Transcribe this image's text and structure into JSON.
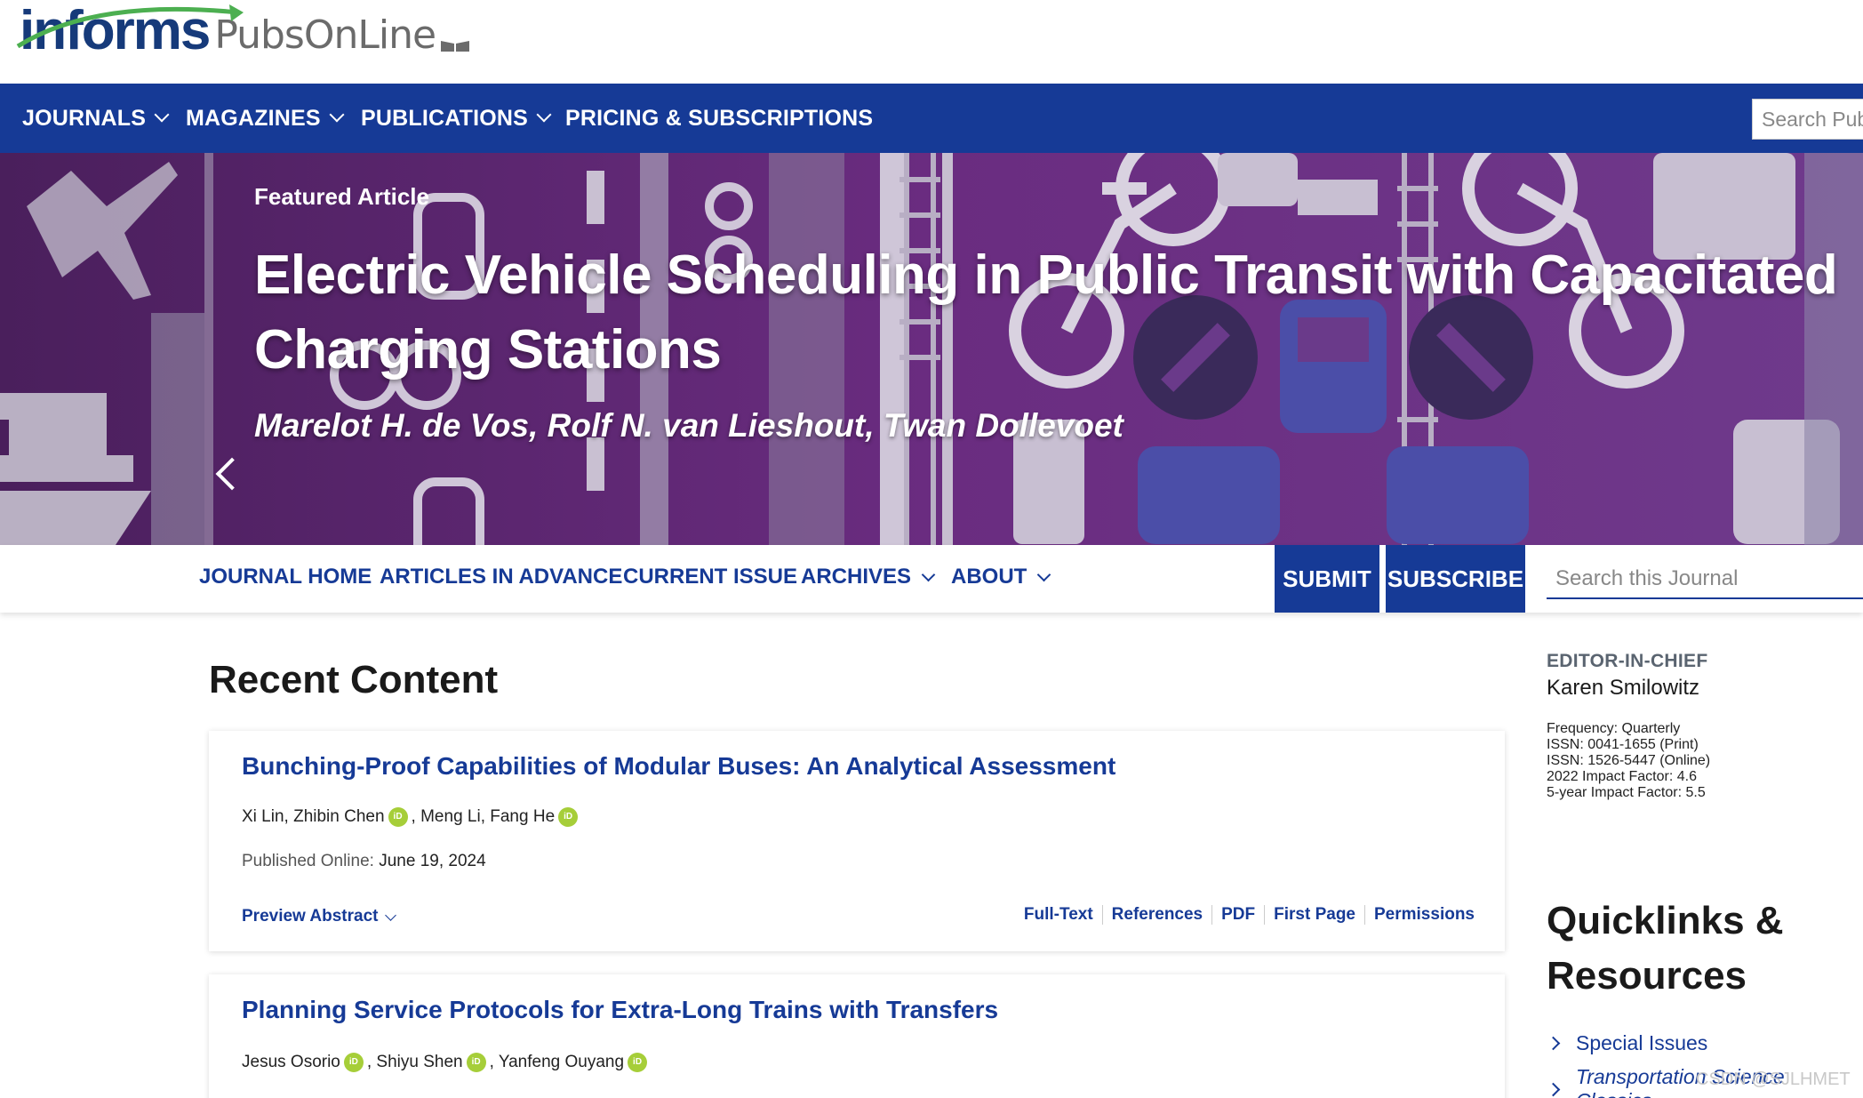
{
  "header": {
    "logo_informs": "informs",
    "logo_pubs": "PubsOnLine"
  },
  "main_nav": {
    "items": [
      {
        "label": "JOURNALS",
        "dropdown": true
      },
      {
        "label": "MAGAZINES",
        "dropdown": true
      },
      {
        "label": "PUBLICATIONS",
        "dropdown": true
      },
      {
        "label": "PRICING & SUBSCRIPTIONS",
        "dropdown": false
      }
    ],
    "search_placeholder": "Search Pub"
  },
  "banner": {
    "kicker": "Featured Article",
    "title": "Electric Vehicle Scheduling in Public Transit with Capacitated Charging Stations",
    "authors": "Marelot H. de Vos, Rolf N. van Lieshout, Twan Dollevoet"
  },
  "journal_nav": {
    "items": [
      "JOURNAL HOME",
      "ARTICLES IN ADVANCE",
      "CURRENT ISSUE",
      "ARCHIVES",
      "ABOUT"
    ],
    "submit": "SUBMIT",
    "subscribe": "SUBSCRIBE",
    "search_placeholder": "Search this Journal"
  },
  "recent": {
    "heading": "Recent Content",
    "articles": [
      {
        "title": "Bunching-Proof Capabilities of Modular Buses: An Analytical Assessment",
        "author_a": "Xi Lin, Zhibin Chen",
        "author_b": ", Meng Li, Fang He",
        "published_label": "Published Online:",
        "published_date": "June 19, 2024",
        "preview": "Preview Abstract",
        "links": [
          "Full-Text",
          "References",
          "PDF",
          "First Page",
          "Permissions"
        ]
      },
      {
        "title": "Planning Service Protocols for Extra-Long Trains with Transfers",
        "author_a": "Jesus Osorio",
        "author_b": ", Shiyu Shen",
        "author_c": ", Yanfeng Ouyang"
      }
    ],
    "orcid_text": "iD"
  },
  "sidebar": {
    "eic_label": "EDITOR-IN-CHIEF",
    "eic_name": "Karen Smilowitz",
    "meta": [
      {
        "k": "Frequency:",
        "v": "Quarterly"
      },
      {
        "k": "ISSN:",
        "v": "0041-1655 (Print)"
      },
      {
        "k": "ISSN:",
        "v": "1526-5447 (Online)"
      },
      {
        "k": "2022 Impact Factor:",
        "v": "4.6"
      },
      {
        "k": "5-year Impact Factor:",
        "v": "5.5"
      }
    ],
    "quicklinks_title": "Quicklinks & Resources",
    "quicklinks": [
      "Special Issues",
      "Transportation Science Classics"
    ]
  },
  "watermark": "CSDN @SJLHMET"
}
